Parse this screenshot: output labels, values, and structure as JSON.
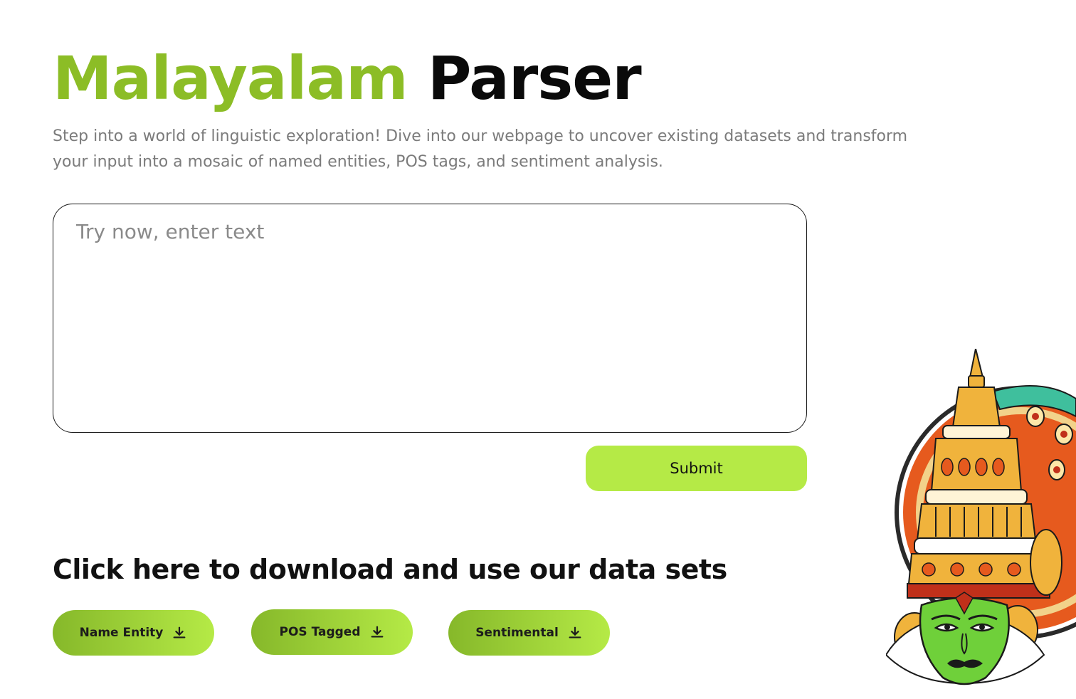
{
  "title": {
    "highlight": "Malayalam",
    "rest": "Parser",
    "highlight_color": "#8cbd26"
  },
  "description": "Step into a world of linguistic exploration! Dive into our webpage to uncover existing datasets and transform your input into a mosaic of named entities, POS tags, and sentiment analysis.",
  "input": {
    "placeholder": "Try now, enter text",
    "value": ""
  },
  "submit": {
    "label": "Submit",
    "color": "#b5ea46"
  },
  "downloads": {
    "heading": "Click here to download and use our data sets",
    "buttons": [
      {
        "label": "Name Entity",
        "icon": "download-icon"
      },
      {
        "label": "POS Tagged",
        "icon": "download-icon"
      },
      {
        "label": "Sentimental",
        "icon": "download-icon"
      }
    ]
  },
  "illustration": {
    "name": "kathakali-face-illustration"
  }
}
